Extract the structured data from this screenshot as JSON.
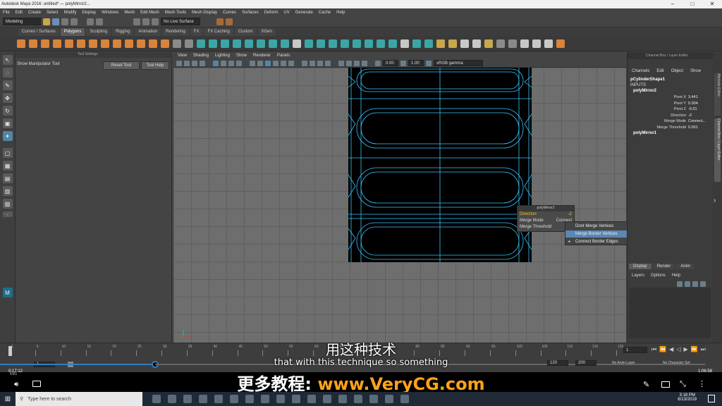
{
  "window": {
    "title": "Autodesk Maya 2016: untitled*   ---   polyMirror2...",
    "minimize": "–",
    "maximize": "□",
    "close": "✕"
  },
  "menubar": [
    "File",
    "Edit",
    "Create",
    "Select",
    "Modify",
    "Display",
    "Windows",
    "Mesh",
    "Edit Mesh",
    "Mesh Tools",
    "Mesh Display",
    "Curves",
    "Surfaces",
    "Deform",
    "UV",
    "Generate",
    "Cache",
    "Help"
  ],
  "status": {
    "mode": "Modeling",
    "live_surface": "No Live Surface"
  },
  "shelf_tabs": [
    {
      "label": "Curves / Surfaces",
      "active": false
    },
    {
      "label": "Polygons",
      "active": true
    },
    {
      "label": "Sculpting",
      "active": false
    },
    {
      "label": "Rigging",
      "active": false
    },
    {
      "label": "Animation",
      "active": false
    },
    {
      "label": "Rendering",
      "active": false
    },
    {
      "label": "FX",
      "active": false
    },
    {
      "label": "FX Caching",
      "active": false
    },
    {
      "label": "Custom",
      "active": false
    },
    {
      "label": "XGen",
      "active": false
    }
  ],
  "tool_settings": {
    "header": "Tool Settings",
    "tool_name": "Show Manipulator Tool",
    "reset": "Reset Tool",
    "help": "Tool Help"
  },
  "viewport": {
    "menu": [
      "View",
      "Shading",
      "Lighting",
      "Show",
      "Renderer",
      "Panels"
    ],
    "field1": "0.00",
    "field2": "1.00",
    "colorspace": "sRGB gamma"
  },
  "popup": {
    "title": "polyMirror2",
    "rows": [
      {
        "label": "Direction",
        "value": "-Z",
        "highlight": true
      },
      {
        "label": "Merge Mode",
        "value": "Connect",
        "highlight": false
      },
      {
        "label": "Merge Threshold",
        "value": "0.",
        "highlight": false
      }
    ]
  },
  "merge_menu": {
    "options": [
      {
        "label": "Dont Merge Vertices",
        "state": "none"
      },
      {
        "label": "Merge Border Vertices",
        "state": "hover"
      },
      {
        "label": "Connect Border Edges",
        "state": "selected"
      }
    ]
  },
  "channel_box": {
    "header": "Channel Box / Layer Editor",
    "menu": [
      "Channels",
      "Edit",
      "Object",
      "Show"
    ],
    "shape": "pCylinderShape1",
    "inputs": "INPUTS",
    "node": "polyMirror2",
    "attrs": [
      {
        "name": "Pivot X",
        "value": "3.441"
      },
      {
        "name": "Pivot Y",
        "value": "0.004"
      },
      {
        "name": "Pivot Z",
        "value": "-9.31"
      },
      {
        "name": "Direction",
        "value": "-Z"
      },
      {
        "name": "Merge Mode",
        "value": "Connect..."
      },
      {
        "name": "Merge Threshold",
        "value": "0.001"
      }
    ],
    "node2": "polyMirror1",
    "side_labels": [
      "Attribute Editor",
      "Channel Box / Layer Editor"
    ]
  },
  "layer_editor": {
    "tabs": [
      "Display",
      "Render",
      "Anim"
    ],
    "menu": [
      "Layers",
      "Options",
      "Help"
    ]
  },
  "timeline": {
    "ticks": [
      "1",
      "5",
      "10",
      "15",
      "20",
      "25",
      "30",
      "35",
      "40",
      "45",
      "50",
      "55",
      "60",
      "65",
      "70",
      "75",
      "80",
      "85",
      "90",
      "95",
      "100",
      "105",
      "110",
      "115",
      "120"
    ],
    "current": "1"
  },
  "range": {
    "start_val": "1",
    "end1": "120",
    "end2": "200",
    "anim_layer": "No Anim Layer",
    "char_set": "No Character Set"
  },
  "video": {
    "elapsed": "0:17:12",
    "label": "KM1",
    "total": "1:06:58"
  },
  "subtitles": {
    "zh": "用这种技术",
    "en": "that with this technique so something",
    "promo_zh": "更多教程:",
    "promo_url": "www.VeryCG.com"
  },
  "taskbar": {
    "search": "Type here to search",
    "time": "3:18 PM",
    "date": "6/13/2019"
  },
  "colors": {
    "accent": "#5285a6",
    "wire": "#39c7ff",
    "menu_highlight": "#5a87b3",
    "popup_highlight": "#f0c020"
  }
}
